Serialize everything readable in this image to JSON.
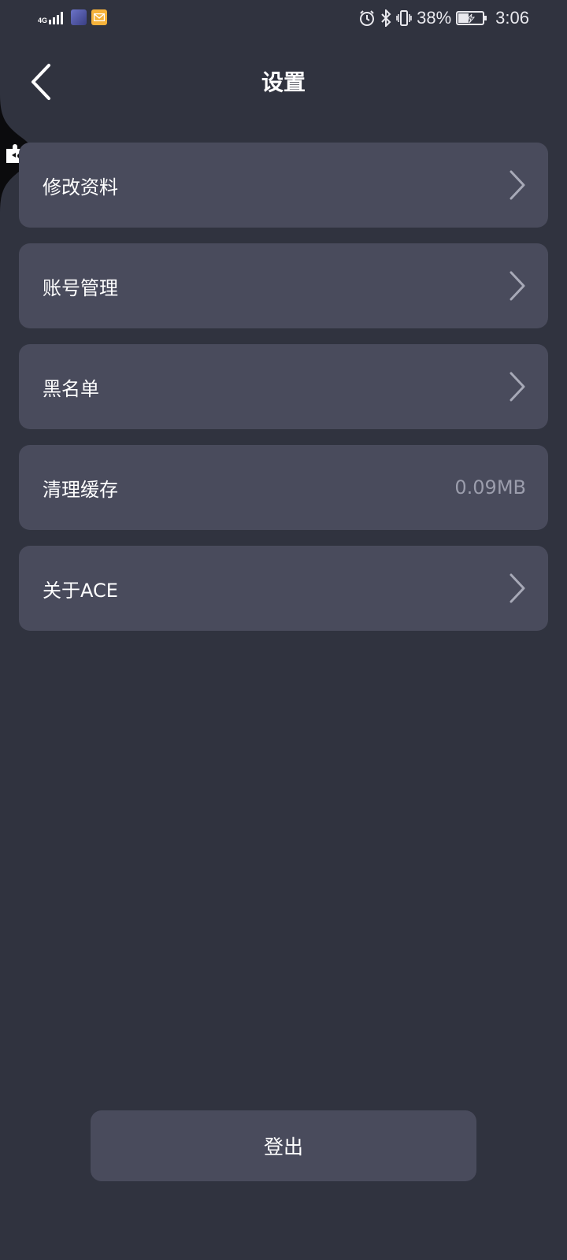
{
  "status_bar": {
    "network": "4G",
    "battery_percent": "38%",
    "time": "3:06"
  },
  "header": {
    "title": "设置"
  },
  "settings": {
    "items": [
      {
        "label": "修改资料",
        "value": "",
        "has_chevron": true
      },
      {
        "label": "账号管理",
        "value": "",
        "has_chevron": true
      },
      {
        "label": "黑名单",
        "value": "",
        "has_chevron": true
      },
      {
        "label": "清理缓存",
        "value": "0.09MB",
        "has_chevron": false
      },
      {
        "label": "关于ACE",
        "value": "",
        "has_chevron": true
      }
    ]
  },
  "logout": {
    "label": "登出"
  },
  "icons": {
    "back": "chevron-left-icon",
    "side_tab": "puzzle-icon",
    "row_arrow": "chevron-right-icon",
    "alarm": "alarm-icon",
    "bluetooth": "bluetooth-icon",
    "vibrate": "vibrate-icon",
    "battery": "battery-charging-icon"
  },
  "colors": {
    "background": "#30333f",
    "card": "#494b5c",
    "muted_text": "#9b9dac"
  }
}
